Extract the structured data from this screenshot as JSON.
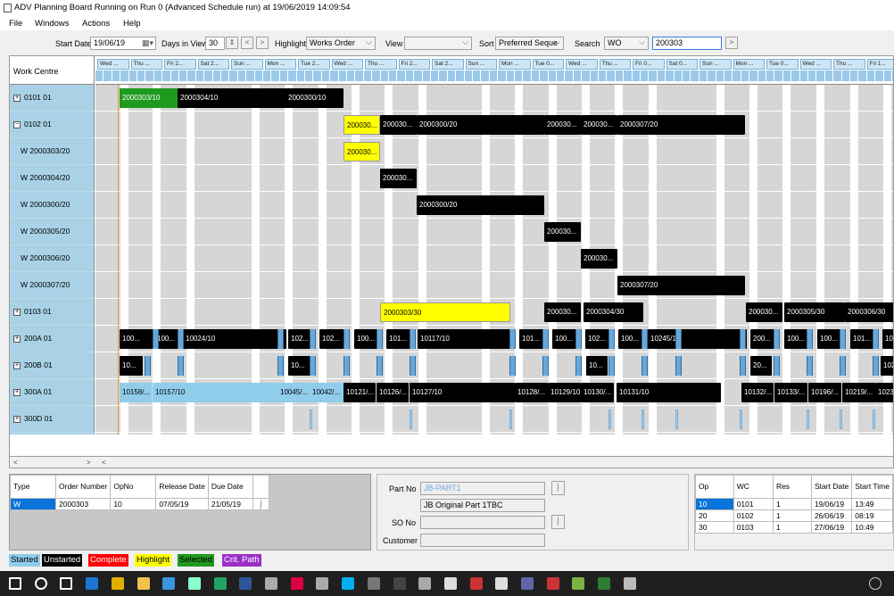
{
  "window": {
    "title": "ADV Planning Board Running on Run 0 (Advanced Schedule run) at 19/06/2019 14:09:54"
  },
  "menu": [
    "File",
    "Windows",
    "Actions",
    "Help"
  ],
  "toolbar": {
    "start_date_label": "Start Date",
    "start_date": "19/06/19",
    "days_label": "Days in View",
    "days": "30",
    "highlight_label": "Highlight",
    "highlight": "Works Order",
    "view_label": "View",
    "view": "",
    "sort_label": "Sort",
    "sort": "Preferred Seque",
    "search_label": "Search",
    "search_field": "WO",
    "search_value": "200303"
  },
  "board": {
    "wc_header": "Work Centre",
    "days": [
      "Wed ...",
      "Thu ...",
      "Fri 2...",
      "Sat 2...",
      "Sun ...",
      "Mon ...",
      "Tue 2...",
      "Wed ...",
      "Thu ...",
      "Fri 2...",
      "Sat 2...",
      "Sun ...",
      "Mon ...",
      "Tue 0...",
      "Wed ...",
      "Thu ...",
      "Fri 0...",
      "Sat 0...",
      "Sun ...",
      "Mon ...",
      "Tue 0...",
      "Wed ...",
      "Thu ...",
      "Fri 1..."
    ],
    "rows": [
      {
        "label": "0101 01",
        "expander": "+"
      },
      {
        "label": "0102 01",
        "expander": "−"
      },
      {
        "label": "W 2000303/20",
        "expander": ""
      },
      {
        "label": "W 2000304/20",
        "expander": ""
      },
      {
        "label": "W 2000300/20",
        "expander": ""
      },
      {
        "label": "W 2000305/20",
        "expander": ""
      },
      {
        "label": "W 2000306/20",
        "expander": ""
      },
      {
        "label": "W 2000307/20",
        "expander": ""
      },
      {
        "label": "0103 01",
        "expander": "+"
      },
      {
        "label": "200A 01",
        "expander": "+"
      },
      {
        "label": "200B 01",
        "expander": "+"
      },
      {
        "label": "300A 01",
        "expander": "+"
      },
      {
        "label": "300D 01",
        "expander": "+"
      }
    ],
    "bars": [
      [
        "2000303/10",
        "2000304/10",
        "2000300/10"
      ],
      [
        "200030...",
        "200030...",
        "2000300/20",
        "200030...",
        "200030...",
        "2000307/20"
      ],
      [
        "200030..."
      ],
      [
        "200030..."
      ],
      [
        "2000300/20"
      ],
      [
        "200030..."
      ],
      [
        "200030..."
      ],
      [
        "2000307/20"
      ],
      [
        "2000303/30",
        "200030...",
        "2000304/30",
        "200030...",
        "2000305/30",
        "2000306/30"
      ],
      [
        "100...",
        "100...",
        "10024/10",
        "102...",
        "102...",
        "100...",
        "101...",
        "10117/10",
        "101...",
        "100...",
        "102...",
        "100...",
        "10245/10",
        "200...",
        "100...",
        "100...",
        "101...",
        "102..."
      ],
      [
        "10...",
        "10...",
        "10...",
        "20...",
        "102..."
      ],
      [
        "10158/...",
        "10157/10",
        "10045/...",
        "10042/...",
        "10121/...",
        "10126/...",
        "10127/10",
        "10128/...",
        "10129/10",
        "10130/...",
        "10131/10",
        "10132/...",
        "10133/...",
        "10196/...",
        "10219/...",
        "1023..."
      ]
    ]
  },
  "order_table": {
    "headers": [
      "Type",
      "Order Number",
      "OpNo",
      "Release Date",
      "Due Date"
    ],
    "row": [
      "W",
      "2000303",
      "10",
      "07/05/19",
      "21/05/19"
    ]
  },
  "part_panel": {
    "part_no_label": "Part No",
    "part_no": "JB-PART1",
    "part_desc": "JB Original Part 1TBC",
    "so_no_label": "SO No",
    "so_no": "",
    "customer_label": "Customer",
    "customer": ""
  },
  "ops_table": {
    "headers": [
      "Op",
      "WC",
      "Res",
      "Start Date",
      "Start Time"
    ],
    "rows": [
      [
        "10",
        "0101",
        "1",
        "19/06/19",
        "13:49"
      ],
      [
        "20",
        "0102",
        "1",
        "26/06/19",
        "08:19"
      ],
      [
        "30",
        "0103",
        "1",
        "27/06/19",
        "10:49"
      ]
    ]
  },
  "legend": [
    {
      "label": "Started",
      "bg": "#8fcdea",
      "fg": "#000000"
    },
    {
      "label": "Unstarted",
      "bg": "#000000",
      "fg": "#ffffff"
    },
    {
      "label": "Complete",
      "bg": "#ff0000",
      "fg": "#ffffff"
    },
    {
      "label": "Highlight",
      "bg": "#ffff00",
      "fg": "#000000"
    },
    {
      "label": "Selected",
      "bg": "#1e9a1e",
      "fg": "#000000"
    },
    {
      "label": "Crit. Path",
      "bg": "#9b30c8",
      "fg": "#ffffff"
    }
  ],
  "taskbar": {
    "icons": [
      "windows-start-icon",
      "search-icon",
      "task-view-icon",
      "outlook-icon",
      "chrome-icon",
      "file-explorer-icon",
      "edge-icon",
      "app-icon",
      "excel-icon",
      "word-icon",
      "app-icon",
      "app-icon",
      "app-icon",
      "skype-icon",
      "app-icon",
      "terminal-icon",
      "app-icon",
      "app-icon",
      "pdf-icon",
      "app-icon",
      "teams-icon",
      "app-icon",
      "app-icon",
      "app-icon",
      "app-icon"
    ],
    "colors": [
      "#ffffff",
      "#ffffff",
      "#ffffff",
      "#1976d2",
      "#e0b000",
      "#f2c14e",
      "#3a96dd",
      "#8fc",
      "#21a366",
      "#2b579a",
      "#aaa",
      "#d04",
      "#aaa",
      "#00aff0",
      "#777",
      "#444",
      "#aaa",
      "#ddd",
      "#c33",
      "#ddd",
      "#6264a7",
      "#c33",
      "#7cb342",
      "#2e7d32",
      "#bbb"
    ]
  }
}
